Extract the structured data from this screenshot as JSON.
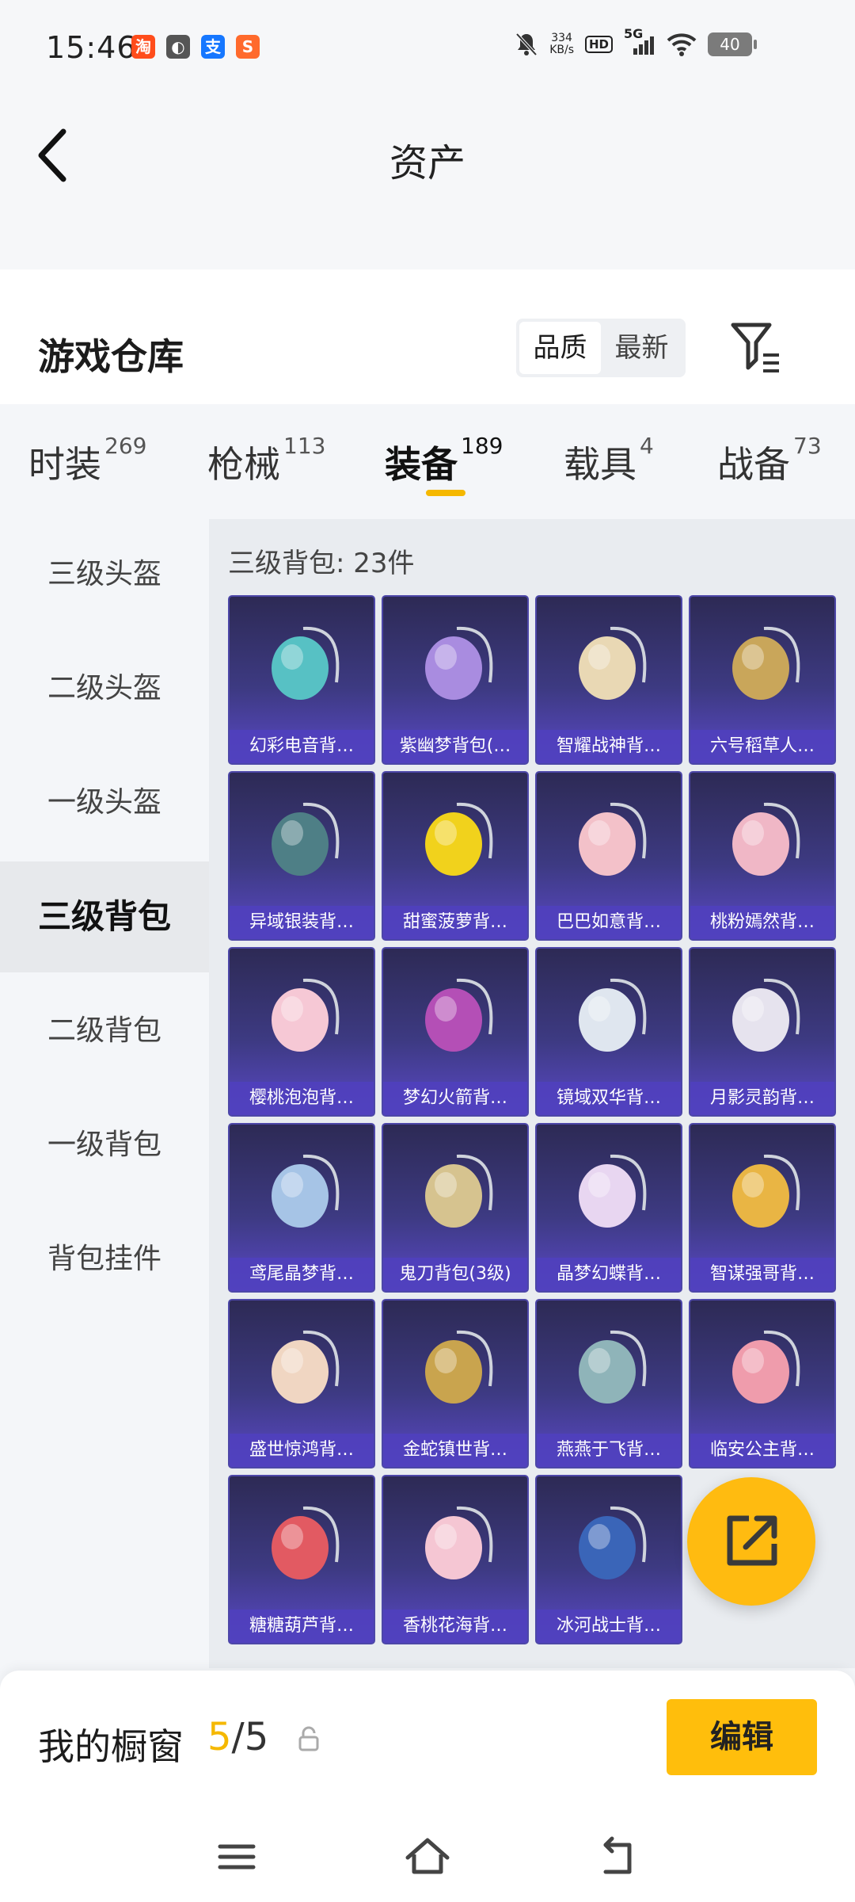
{
  "status_bar": {
    "time": "15:46",
    "apps": [
      {
        "icon": "taobao-icon",
        "glyph": "淘",
        "color": "#ff4d1c"
      },
      {
        "icon": "browser-icon",
        "glyph": "◐",
        "color": "#555555"
      },
      {
        "icon": "alipay-icon",
        "glyph": "支",
        "color": "#1677ff"
      },
      {
        "icon": "app-s-icon",
        "glyph": "S",
        "color": "#ff6a2c"
      }
    ],
    "net_speed_value": "334",
    "net_speed_unit": "KB/s",
    "hd": "HD",
    "signal": "5G",
    "battery": "40"
  },
  "header": {
    "title": "资产"
  },
  "warehouse": {
    "title": "游戏仓库",
    "sort_options": [
      "品质",
      "最新"
    ],
    "active_sort": "品质"
  },
  "category_tabs": [
    {
      "name": "时装",
      "count": "269",
      "active": false
    },
    {
      "name": "枪械",
      "count": "113",
      "active": false
    },
    {
      "name": "装备",
      "count": "189",
      "active": true
    },
    {
      "name": "载具",
      "count": "4",
      "active": false
    },
    {
      "name": "战备",
      "count": "73",
      "active": false
    }
  ],
  "side_nav": [
    {
      "label": "三级头盔",
      "active": false
    },
    {
      "label": "二级头盔",
      "active": false
    },
    {
      "label": "一级头盔",
      "active": false
    },
    {
      "label": "三级背包",
      "active": true
    },
    {
      "label": "二级背包",
      "active": false
    },
    {
      "label": "一级背包",
      "active": false
    },
    {
      "label": "背包挂件",
      "active": false
    }
  ],
  "content": {
    "count_label": "三级背包: 23件",
    "items": [
      {
        "name": "幻彩电音背…",
        "color": "#57c1c4"
      },
      {
        "name": "紫幽梦背包(…",
        "color": "#a98ce0"
      },
      {
        "name": "智耀战神背…",
        "color": "#e9d8b4"
      },
      {
        "name": "六号稻草人…",
        "color": "#c9a65a"
      },
      {
        "name": "异域银装背…",
        "color": "#4e7f86"
      },
      {
        "name": "甜蜜菠萝背…",
        "color": "#f1d21c"
      },
      {
        "name": "巴巴如意背…",
        "color": "#f3c1c9"
      },
      {
        "name": "桃粉嫣然背…",
        "color": "#f0b7c6"
      },
      {
        "name": "樱桃泡泡背…",
        "color": "#f6c8d5"
      },
      {
        "name": "梦幻火箭背…",
        "color": "#b44fb6"
      },
      {
        "name": "镜域双华背…",
        "color": "#dfe6ef"
      },
      {
        "name": "月影灵韵背…",
        "color": "#e6e3ee"
      },
      {
        "name": "鸢尾晶梦背…",
        "color": "#a6c4e6"
      },
      {
        "name": "鬼刀背包(3级)",
        "color": "#d6c38f"
      },
      {
        "name": "晶梦幻蝶背…",
        "color": "#e8d6f1"
      },
      {
        "name": "智谋强哥背…",
        "color": "#e9b544"
      },
      {
        "name": "盛世惊鸿背…",
        "color": "#f0d6c2"
      },
      {
        "name": "金蛇镇世背…",
        "color": "#c9a44e"
      },
      {
        "name": "燕燕于飞背…",
        "color": "#8fb4b9"
      },
      {
        "name": "临安公主背…",
        "color": "#ef9cac"
      },
      {
        "name": "糖糖葫芦背…",
        "color": "#e25a62"
      },
      {
        "name": "香桃花海背…",
        "color": "#f5c6d3"
      },
      {
        "name": "冰河战士背…",
        "color": "#3a65b8"
      }
    ]
  },
  "showcase": {
    "title": "我的橱窗",
    "current": "5",
    "separator": "/",
    "total": "5",
    "edit_label": "编辑"
  },
  "colors": {
    "accent": "#f5b800",
    "card_top": "#2d2a55",
    "card_bottom": "#5a48c6"
  }
}
